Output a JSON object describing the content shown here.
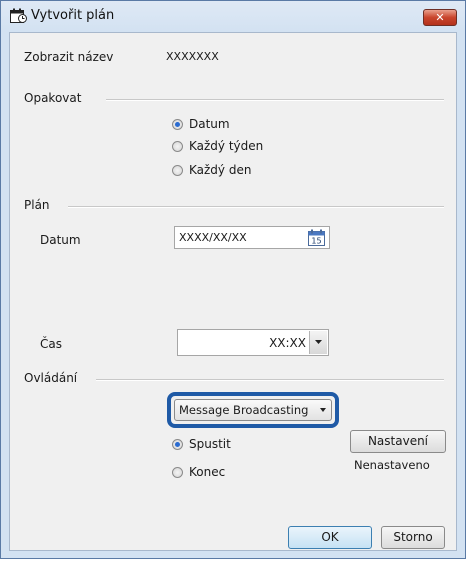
{
  "window": {
    "title": "Vytvořit plán",
    "close_label": "✕"
  },
  "display_name": {
    "label": "Zobrazit název",
    "value": "XXXXXXX"
  },
  "repeat": {
    "heading": "Opakovat",
    "options": [
      "Datum",
      "Každý týden",
      "Každý den"
    ],
    "selected": 0
  },
  "plan": {
    "heading": "Plán",
    "date_label": "Datum",
    "date_value": "XXXX/XX/XX",
    "calendar_day": "15",
    "time_label": "Čas",
    "time_value": "XX:XX"
  },
  "control": {
    "heading": "Ovládání",
    "dropdown_value": "Message Broadcasting",
    "highlight_color": "#1f5aa6",
    "start_label": "Spustit",
    "end_label": "Konec",
    "settings_button": "Nastavení",
    "settings_status": "Nenastaveno"
  },
  "footer": {
    "ok_label": "OK",
    "cancel_label": "Storno"
  }
}
